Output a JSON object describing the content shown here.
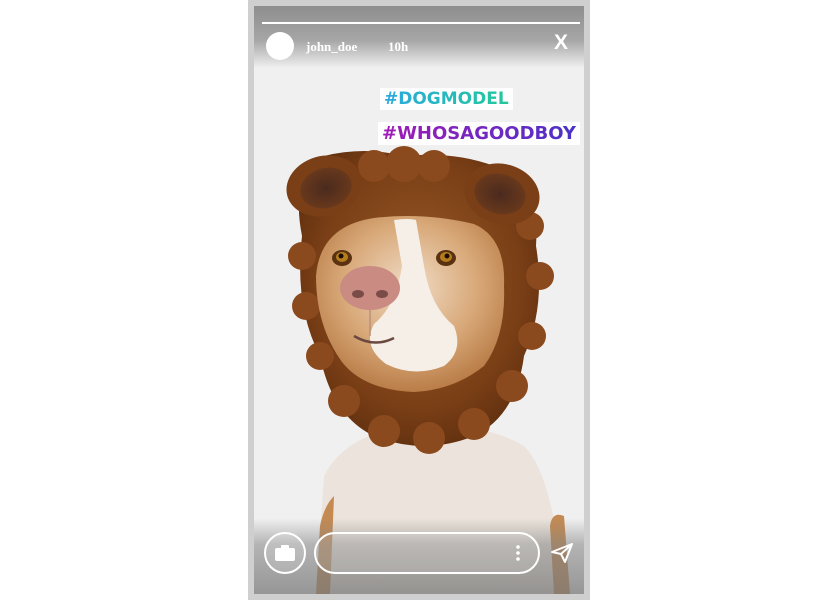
{
  "story": {
    "username": "john_doe",
    "timestamp": "10h",
    "close_label": "X",
    "progress": 1.0,
    "background_color": "#f1f0f1"
  },
  "stickers": {
    "hashtag_1": "#DOGMODEL",
    "hashtag_2": "#WHOSAGOODBOY"
  },
  "reply": {
    "placeholder": ""
  },
  "icons": {
    "camera": "camera-icon",
    "more": "vertical-dots-icon",
    "send": "paper-plane-icon",
    "close": "close-icon"
  }
}
